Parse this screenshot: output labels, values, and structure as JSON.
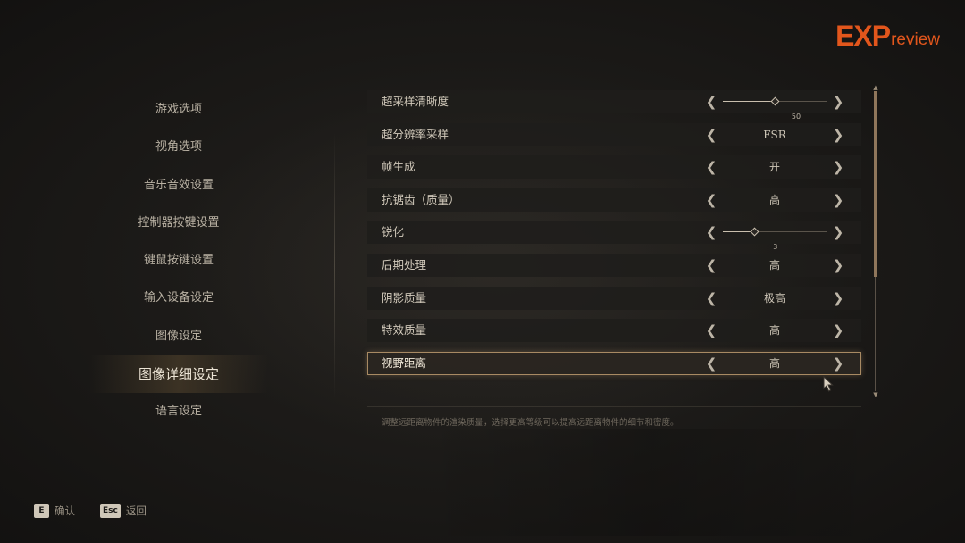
{
  "logo": {
    "exp": "EXP",
    "review": "review"
  },
  "nav": {
    "items": [
      {
        "label": "游戏选项"
      },
      {
        "label": "视角选项"
      },
      {
        "label": "音乐音效设置"
      },
      {
        "label": "控制器按键设置"
      },
      {
        "label": "键鼠按键设置"
      },
      {
        "label": "输入设备设定"
      },
      {
        "label": "图像设定"
      },
      {
        "label": "图像详细设定",
        "active": true
      },
      {
        "label": "语言设定"
      }
    ]
  },
  "settings": [
    {
      "label": "超采样清晰度",
      "type": "slider",
      "value": 50,
      "min": 0,
      "max": 100
    },
    {
      "label": "超分辨率采样",
      "type": "choice",
      "value": "FSR"
    },
    {
      "label": "帧生成",
      "type": "choice",
      "value": "开"
    },
    {
      "label": "抗锯齿（质量）",
      "type": "choice",
      "value": "高"
    },
    {
      "label": "锐化",
      "type": "slider",
      "value": 3,
      "min": 0,
      "max": 10
    },
    {
      "label": "后期处理",
      "type": "choice",
      "value": "高"
    },
    {
      "label": "阴影质量",
      "type": "choice",
      "value": "极高"
    },
    {
      "label": "特效质量",
      "type": "choice",
      "value": "高"
    },
    {
      "label": "视野距离",
      "type": "choice",
      "value": "高",
      "selected": true
    }
  ],
  "scroll": {
    "position_fraction": 0.0,
    "visible_fraction": 0.62
  },
  "description": "调整远距离物件的渲染质量，选择更高等级可以提高远距离物件的细节和密度。",
  "hints": [
    {
      "key": "E",
      "label": "确认"
    },
    {
      "key": "Esc",
      "label": "返回"
    }
  ],
  "colors": {
    "accent": "#e2561c",
    "selection_border": "#a88a63",
    "scroll_thumb": "#8f765b"
  }
}
